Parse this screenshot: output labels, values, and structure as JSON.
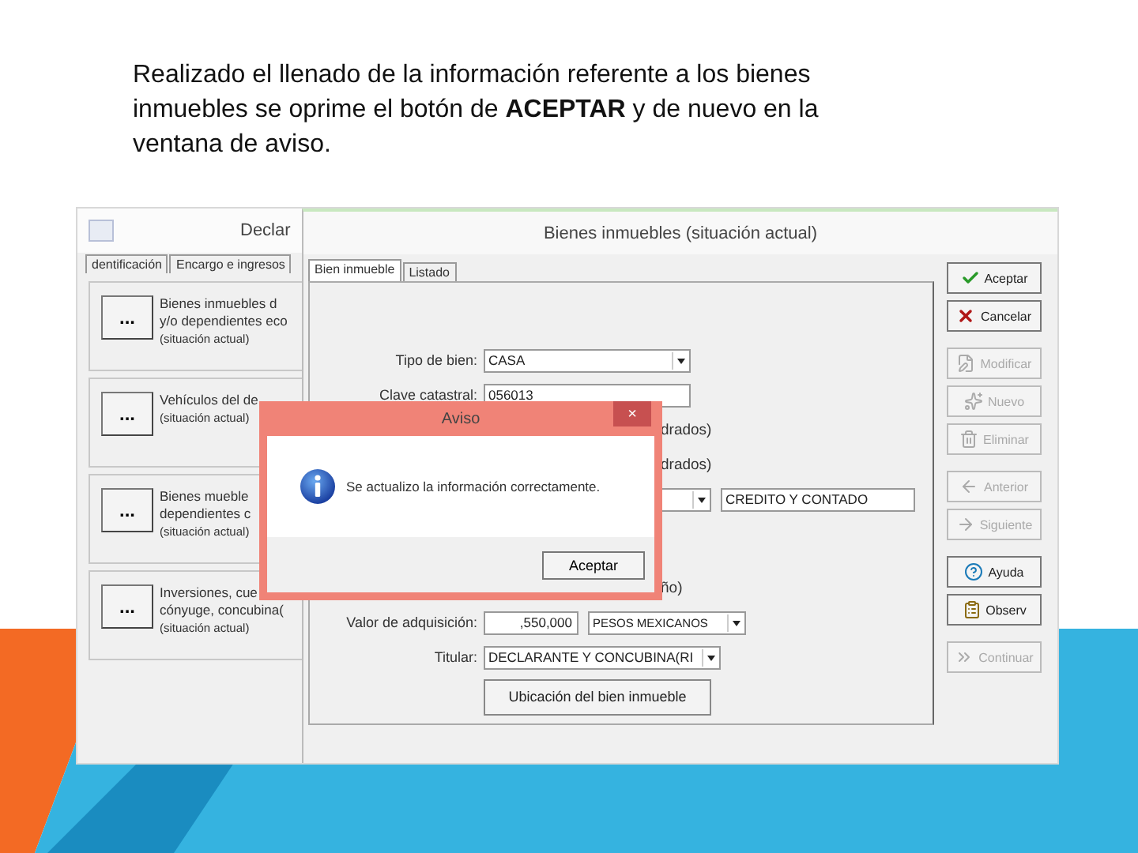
{
  "caption": "Realizado el llenado de la información referente a los bienes inmuebles se oprime el botón de **ACEPTAR** y de nuevo en la ventana de aviso.",
  "back_window": {
    "title": "Declar",
    "tabs": [
      {
        "label": "dentificación",
        "selected": false
      },
      {
        "label": "Encargo e ingresos",
        "selected": false
      }
    ],
    "cards": [
      {
        "button": "...",
        "lines": [
          "Bienes inmuebles d",
          "y/o dependientes eco",
          "(situación actual)"
        ]
      },
      {
        "button": "...",
        "lines": [
          "Vehículos del de",
          "(situación actual)"
        ]
      },
      {
        "button": "...",
        "lines": [
          "Bienes mueble",
          "dependientes c",
          "(situación actual)"
        ]
      },
      {
        "button": "...",
        "lines": [
          "Inversiones, cue",
          "cónyuge, concubina(",
          "(situación actual)"
        ]
      }
    ]
  },
  "main_window": {
    "title": "Bienes inmuebles (situación actual)",
    "tabs": [
      {
        "label": "Bien inmueble",
        "selected": true
      },
      {
        "label": "Listado",
        "selected": false
      }
    ],
    "form": [
      {
        "kind": "select",
        "label": "Tipo de bien:",
        "value": "CASA"
      },
      {
        "kind": "input",
        "label": "Clave catastral:",
        "value": "056013"
      },
      {
        "kind": "note",
        "value": "drados)"
      },
      {
        "kind": "note",
        "value": "drados)"
      },
      {
        "kind": "select_text",
        "value": "CREDITO Y CONTADO"
      },
      {
        "kind": "note",
        "value": "ño)"
      },
      {
        "kind": "amount",
        "label": "Valor de adquisición:",
        "value": ",550,000",
        "currency": "PESOS MEXICANOS"
      },
      {
        "kind": "select",
        "label": "Titular:",
        "value": "DECLARANTE Y CONCUBINA(RI"
      },
      {
        "kind": "button",
        "value": "Ubicación del bien inmueble"
      }
    ],
    "button_groups": [
      [
        {
          "label": "Aceptar",
          "kind": "check",
          "disabled": false
        },
        {
          "label": "Cancelar",
          "kind": "cross",
          "disabled": false
        }
      ],
      [
        {
          "label": "Modificar",
          "kind": "edit",
          "disabled": true
        },
        {
          "label": "Nuevo",
          "kind": "new",
          "disabled": true
        },
        {
          "label": "Eliminar",
          "kind": "trash",
          "disabled": true
        }
      ],
      [
        {
          "label": "Anterior",
          "kind": "prev",
          "disabled": true
        },
        {
          "label": "Siguiente",
          "kind": "next",
          "disabled": true
        }
      ],
      [
        {
          "label": "Ayuda",
          "kind": "help",
          "disabled": false
        },
        {
          "label": "Observ",
          "kind": "notes",
          "disabled": false
        }
      ],
      [
        {
          "label": "Continuar",
          "kind": "forward",
          "disabled": true
        }
      ]
    ]
  },
  "dialog": {
    "title": "Aviso",
    "close": "×",
    "message": "Se actualizo la información correctamente.",
    "button": "Aceptar"
  }
}
